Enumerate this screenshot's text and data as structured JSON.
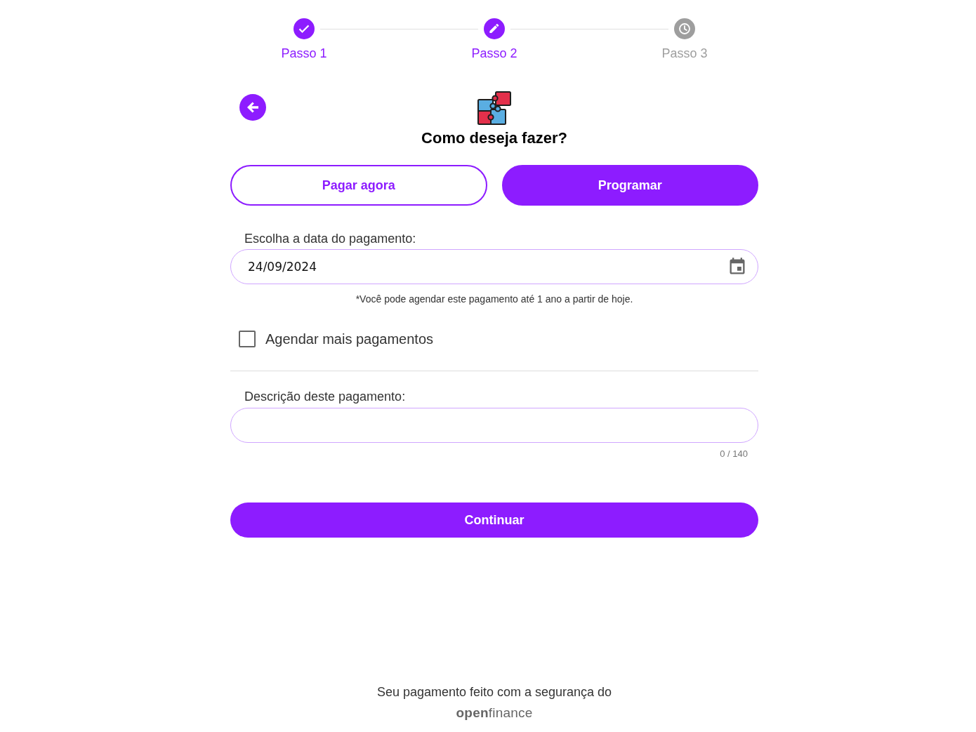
{
  "steps": [
    {
      "label": "Passo 1",
      "kind": "done"
    },
    {
      "label": "Passo 2",
      "kind": "current"
    },
    {
      "label": "Passo 3",
      "kind": "pending"
    }
  ],
  "header": {
    "title": "Como deseja fazer?"
  },
  "modes": [
    {
      "label": "Pagar agora",
      "selected": false
    },
    {
      "label": "Programar",
      "selected": true
    }
  ],
  "date_field": {
    "label": "Escolha a data do pagamento:",
    "value": "24/09/2024",
    "note": "*Você pode agendar este pagamento até 1 ano a partir de hoje."
  },
  "schedule_more": {
    "label": "Agendar mais pagamentos",
    "checked": false
  },
  "description_field": {
    "label": "Descrição deste pagamento:",
    "counter": "0 / 140"
  },
  "continue_button": {
    "label": "Continuar"
  },
  "footer": {
    "text": "Seu pagamento feito com a segurança do",
    "logo": "**open**finance"
  }
}
